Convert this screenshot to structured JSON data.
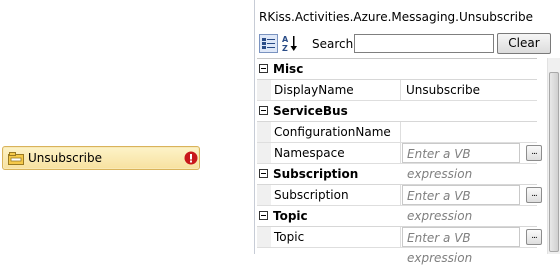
{
  "canvas": {
    "activity": {
      "label": "Unsubscribe",
      "icon": "activity-folder-icon",
      "status_icon": "error-icon"
    }
  },
  "property_panel": {
    "title": "RKiss.Activities.Azure.Messaging.Unsubscribe",
    "toolbar": {
      "categorized_icon": "categorized-view-icon",
      "alphabetical_icon": "sort-alphabetical-icon",
      "search_label": "Search:",
      "search_value": "",
      "clear_label": "Clear"
    },
    "categories": [
      {
        "name": "Misc",
        "properties": [
          {
            "name": "DisplayName",
            "value": "Unsubscribe"
          }
        ]
      },
      {
        "name": "ServiceBus",
        "properties": [
          {
            "name": "ConfigurationName",
            "value": ""
          },
          {
            "name": "Namespace",
            "value": "Enter a VB expression"
          }
        ]
      },
      {
        "name": "Subscription",
        "properties": [
          {
            "name": "Subscription",
            "value": "Enter a VB expression"
          }
        ]
      },
      {
        "name": "Topic",
        "properties": [
          {
            "name": "Topic",
            "value": "Enter a VB expression"
          }
        ]
      }
    ],
    "ellipsis_label": "..."
  },
  "colors": {
    "activity_fill": "#f7e1a0",
    "activity_border": "#d9b35b",
    "error_red": "#c8171b",
    "placeholder_gray": "#7f7f7f"
  }
}
